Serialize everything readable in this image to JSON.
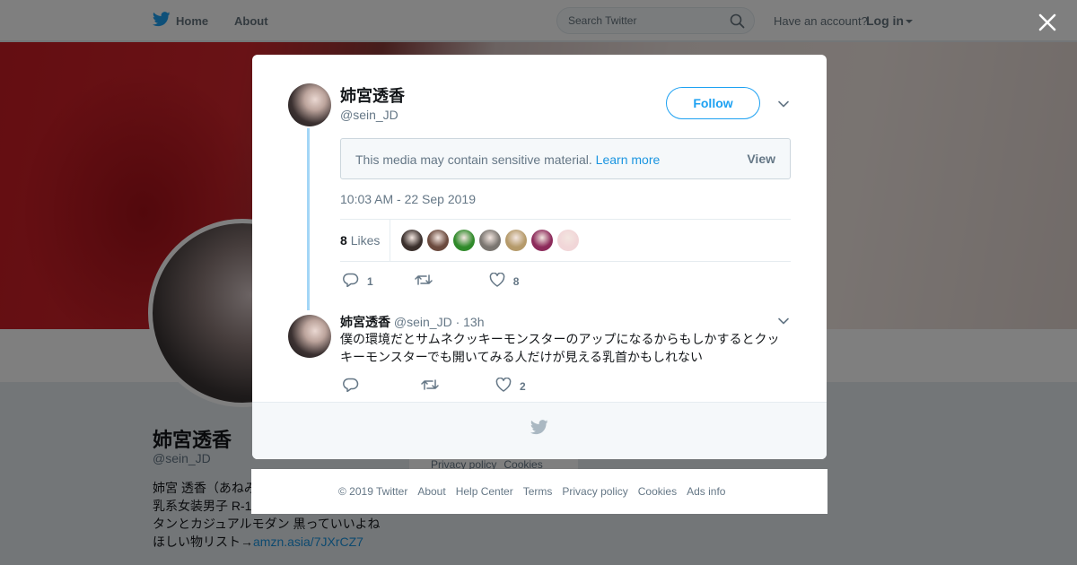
{
  "nav": {
    "home_label": "Home",
    "about_label": "About",
    "search_placeholder": "Search Twitter",
    "have_account": "Have an account?",
    "login_label": "Log in"
  },
  "background_profile": {
    "name": "姉宮透香",
    "handle": "@sein_JD",
    "bio_line1": "姉宮 透香（あねみ",
    "bio_line2": "乳系女装男子 R-1",
    "bio_line3": "タンとカジュアルモダン 黒っていいよね",
    "bio_line4_prefix": "ほしい物リスト→",
    "bio_link": "amzn.asia/7JXrCZ7",
    "card_links": [
      "Privacy policy",
      "Cookies"
    ]
  },
  "tweet": {
    "author_name": "姉宮透香",
    "author_handle": "@sein_JD",
    "follow_label": "Follow",
    "sensitive_text": "This media may contain sensitive material.",
    "learn_more": "Learn more",
    "view_label": "View",
    "timestamp": "10:03 AM - 22 Sep 2019",
    "likes_count": "8",
    "likes_label": "Likes",
    "liker_colors": [
      "#3a2f2c",
      "#6b4a3e",
      "#2f8a2a",
      "#7a7570",
      "#b59a6a",
      "#8c2a5a",
      "#f1d6d8"
    ],
    "reply_count": "1",
    "retweet_count": "",
    "like_count": "8"
  },
  "reply": {
    "author_name": "姉宮透香",
    "author_handle": "@sein_JD",
    "time": "13h",
    "text": "僕の環境だとサムネクッキーモンスターのアップになるからもしかするとクッキーモンスターでも開いてみる人だけが見える乳首かもしれない",
    "reply_count": "",
    "retweet_count": "",
    "like_count": "2"
  },
  "footer": {
    "links": [
      "© 2019 Twitter",
      "About",
      "Help Center",
      "Terms",
      "Privacy policy",
      "Cookies",
      "Ads info"
    ]
  },
  "colors": {
    "accent": "#1da1f2",
    "link": "#1b95e0",
    "muted": "#657786",
    "thread_line": "#a3d6f6"
  }
}
